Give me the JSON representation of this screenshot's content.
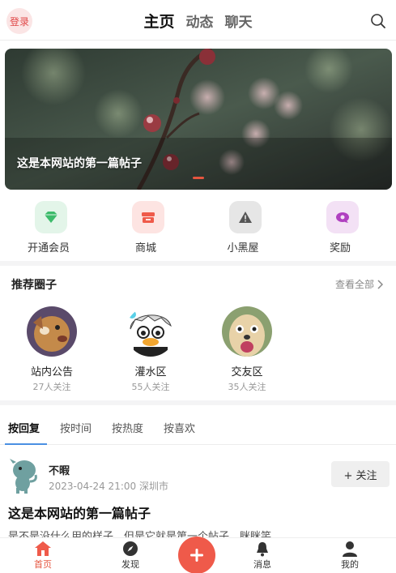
{
  "header": {
    "login_label": "登录",
    "tabs": [
      {
        "label": "主页",
        "active": true
      },
      {
        "label": "动态",
        "active": false
      },
      {
        "label": "聊天",
        "active": false
      }
    ],
    "search_icon": "search-icon"
  },
  "banner": {
    "caption": "这是本网站的第一篇帖子",
    "indicator_color": "#e5553f"
  },
  "quick_links": [
    {
      "label": "开通会员",
      "icon": "diamond-icon",
      "color": "#3dbb6b",
      "bg": "#e3f5e9"
    },
    {
      "label": "商城",
      "icon": "shop-icon",
      "color": "#ef5a4a",
      "bg": "#fde4e2"
    },
    {
      "label": "小黑屋",
      "icon": "warning-icon",
      "color": "#555555",
      "bg": "#e6e6e6"
    },
    {
      "label": "奖励",
      "icon": "reward-icon",
      "color": "#b040c0",
      "bg": "#f3e1f5"
    }
  ],
  "recommended": {
    "title": "推荐圈子",
    "see_all": "查看全部",
    "circles": [
      {
        "name": "站内公告",
        "followers": "27人关注"
      },
      {
        "name": "灌水区",
        "followers": "55人关注"
      },
      {
        "name": "交友区",
        "followers": "35人关注"
      }
    ]
  },
  "sort_tabs": [
    {
      "label": "按回复",
      "active": true
    },
    {
      "label": "按时间",
      "active": false
    },
    {
      "label": "按热度",
      "active": false
    },
    {
      "label": "按喜欢",
      "active": false
    }
  ],
  "post": {
    "username": "不暇",
    "meta": "2023-04-24 21:00 深圳市",
    "follow_label": "+ 关注",
    "title": "这是本网站的第一篇帖子",
    "excerpt": "是不是没什么用的样子，但是它就是第一个帖子，眯眯笑"
  },
  "bottom_nav": [
    {
      "label": "首页",
      "icon": "home-icon",
      "active": true
    },
    {
      "label": "发现",
      "icon": "compass-icon",
      "active": false
    },
    {
      "label": "消息",
      "icon": "bell-icon",
      "active": false
    },
    {
      "label": "我的",
      "icon": "user-icon",
      "active": false
    }
  ],
  "fab_icon": "plus-icon",
  "accent_color": "#e5553f"
}
